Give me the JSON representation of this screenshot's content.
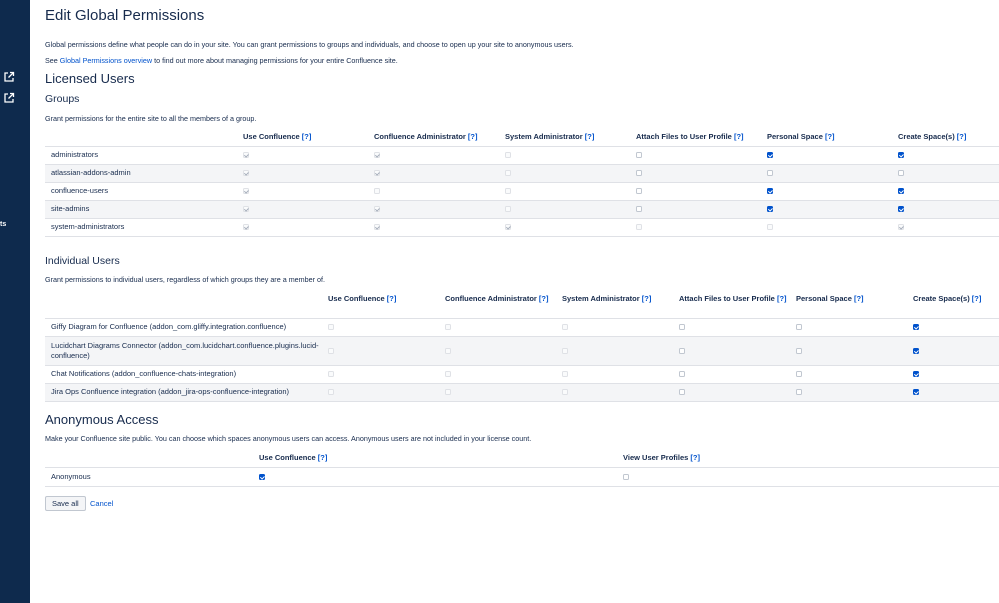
{
  "page": {
    "title": "Edit Global Permissions",
    "intro_line1": "Global permissions define what people can do in your site. You can grant permissions to groups and individuals, and choose to open up your site to anonymous users.",
    "intro_line2_prefix": "See ",
    "intro_link": "Global Permissions overview",
    "intro_line2_suffix": " to find out more about managing permissions for your entire Confluence site."
  },
  "sidebar": {
    "icons": [
      "external-link-icon",
      "external-link-icon"
    ],
    "fragment_text": "ts"
  },
  "licensed_users": {
    "heading": "Licensed Users",
    "groups": {
      "heading": "Groups",
      "description": "Grant permissions for the entire site to all the members of a group.",
      "columns": [
        "Use Confluence",
        "Confluence Administrator",
        "System Administrator",
        "Attach Files to User Profile",
        "Personal Space",
        "Create Space(s)"
      ],
      "help_label": "[?]",
      "rows": [
        {
          "name": "administrators",
          "perms": [
            "checked-disabled",
            "checked-disabled",
            "disabled",
            "unchecked",
            "checked",
            "checked"
          ]
        },
        {
          "name": "atlassian-addons-admin",
          "perms": [
            "checked-disabled",
            "checked-disabled",
            "disabled",
            "unchecked",
            "unchecked",
            "unchecked"
          ]
        },
        {
          "name": "confluence-users",
          "perms": [
            "checked-disabled",
            "disabled",
            "disabled",
            "unchecked",
            "checked",
            "checked"
          ]
        },
        {
          "name": "site-admins",
          "perms": [
            "checked-disabled",
            "checked-disabled",
            "disabled",
            "unchecked",
            "checked",
            "checked"
          ]
        },
        {
          "name": "system-administrators",
          "perms": [
            "checked-disabled",
            "checked-disabled",
            "checked-disabled",
            "disabled",
            "disabled",
            "checked-disabled"
          ]
        }
      ]
    },
    "individual": {
      "heading": "Individual Users",
      "description": "Grant permissions to individual users, regardless of which groups they are a member of.",
      "columns": [
        "Use Confluence",
        "Confluence Administrator",
        "System Administrator",
        "Attach Files to User Profile",
        "Personal Space",
        "Create Space(s)"
      ],
      "help_label": "[?]",
      "rows": [
        {
          "name": "Giffy Diagram for Confluence (addon_com.gliffy.integration.confluence)",
          "perms": [
            "disabled",
            "disabled",
            "disabled",
            "unchecked",
            "unchecked",
            "checked"
          ]
        },
        {
          "name": "Lucidchart Diagrams Connector (addon_com.lucidchart.confluence.plugins.lucid-confluence)",
          "perms": [
            "disabled",
            "disabled",
            "disabled",
            "unchecked",
            "unchecked",
            "checked"
          ]
        },
        {
          "name": "Chat Notifications (addon_confluence-chats-integration)",
          "perms": [
            "disabled",
            "disabled",
            "disabled",
            "unchecked",
            "unchecked",
            "checked"
          ]
        },
        {
          "name": "Jira Ops Confluence integration (addon_jira-ops-confluence-integration)",
          "perms": [
            "disabled",
            "disabled",
            "disabled",
            "unchecked",
            "unchecked",
            "checked"
          ]
        }
      ]
    }
  },
  "anonymous": {
    "heading": "Anonymous Access",
    "description": "Make your Confluence site public. You can choose which spaces anonymous users can access. Anonymous users are not included in your license count.",
    "columns": [
      "Use Confluence",
      "View User Profiles"
    ],
    "help_label": "[?]",
    "rows": [
      {
        "name": "Anonymous",
        "perms": [
          "checked",
          "unchecked"
        ]
      }
    ]
  },
  "actions": {
    "save_label": "Save all",
    "cancel_label": "Cancel"
  }
}
